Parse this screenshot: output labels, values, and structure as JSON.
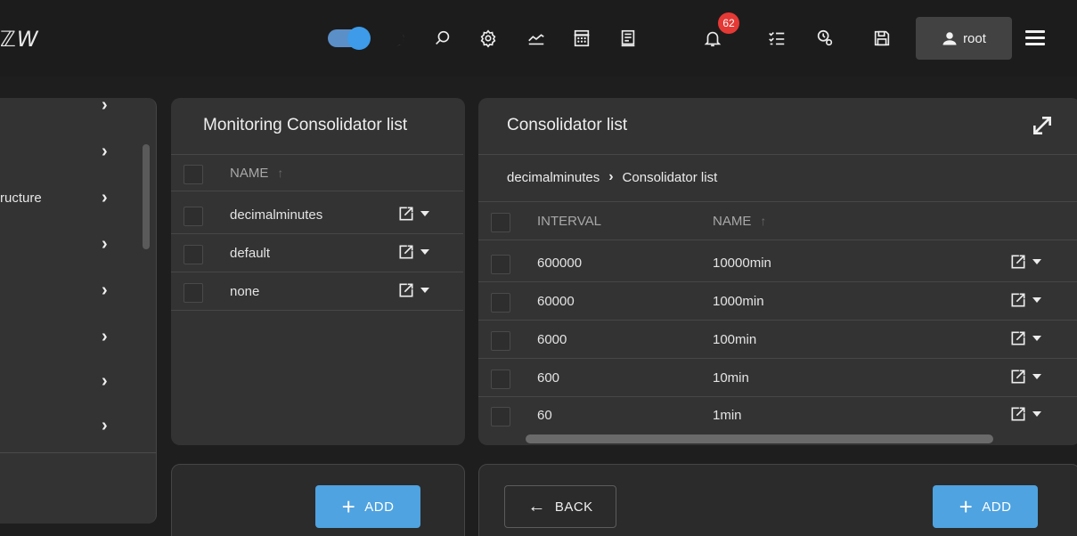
{
  "header": {
    "brand": "ℤW",
    "notification_count": "62",
    "user_label": "root",
    "icons": [
      "theme-toggle",
      "moon-icon",
      "search-icon",
      "settings-icon",
      "chart-icon",
      "calculator-icon",
      "report-icon",
      "bell-icon",
      "tasklist-icon",
      "clock-gear-icon",
      "save-icon",
      "user-icon",
      "hamburger-menu-icon"
    ]
  },
  "sidebar": {
    "items": [
      {
        "label": ""
      },
      {
        "label": ""
      },
      {
        "label": "ructure"
      },
      {
        "label": ""
      },
      {
        "label": ""
      },
      {
        "label": ""
      },
      {
        "label": ""
      },
      {
        "label": ""
      }
    ]
  },
  "monitoring_panel": {
    "title": "Monitoring Consolidator list",
    "column_name": "NAME",
    "rows": [
      {
        "name": "decimalminutes"
      },
      {
        "name": "default"
      },
      {
        "name": "none"
      }
    ],
    "add_label": "ADD"
  },
  "consolidator_panel": {
    "title": "Consolidator list",
    "breadcrumb": [
      "decimalminutes",
      "Consolidator list"
    ],
    "columns": {
      "interval": "INTERVAL",
      "name": "NAME"
    },
    "rows": [
      {
        "interval": "600000",
        "name": "10000min"
      },
      {
        "interval": "60000",
        "name": "1000min"
      },
      {
        "interval": "6000",
        "name": "100min"
      },
      {
        "interval": "600",
        "name": "10min"
      },
      {
        "interval": "60",
        "name": "1min"
      }
    ],
    "back_label": "BACK",
    "add_label": "ADD"
  },
  "colors": {
    "accent": "#4fa3e0",
    "badge": "#e53935",
    "panel": "#333333",
    "background": "#1e1e1e"
  }
}
